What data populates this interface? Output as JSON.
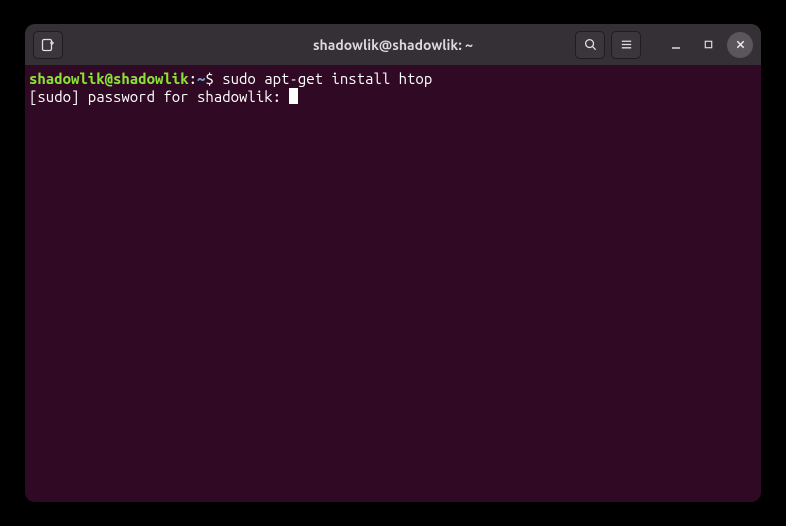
{
  "window": {
    "title": "shadowlik@shadowlik: ~"
  },
  "terminal": {
    "prompt": {
      "userhost": "shadowlik@shadowlik",
      "separator": ":",
      "path": "~",
      "symbol": "$"
    },
    "command": "sudo apt-get install htop",
    "output_line": "[sudo] password for shadowlik: "
  }
}
